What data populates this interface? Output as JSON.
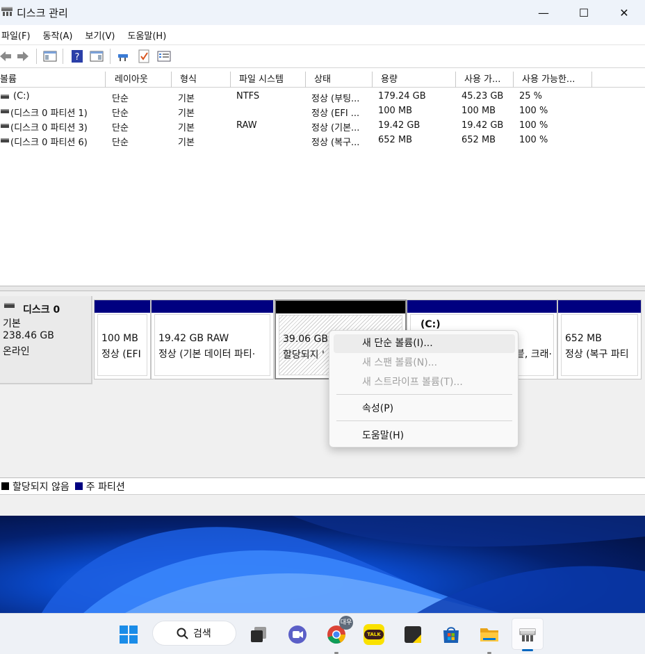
{
  "window": {
    "title": "디스크 관리",
    "minimize_glyph": "—",
    "maximize_glyph": "☐",
    "close_glyph": "✕"
  },
  "menu": [
    "파일(F)",
    "동작(A)",
    "보기(V)",
    "도움말(H)"
  ],
  "toolbar": {
    "icons": [
      "back-arrow-icon",
      "forward-arrow-icon",
      "show-hide-console-tree-icon",
      "help-icon",
      "show-hide-action-pane-icon",
      "connect-icon",
      "checklist-icon",
      "properties-icon"
    ]
  },
  "volume_table": {
    "columns": [
      "볼륨",
      "레이아웃",
      "형식",
      "파일 시스템",
      "상태",
      "용량",
      "사용 가...",
      "사용 가능한..."
    ],
    "rows": [
      [
        "(C:)",
        "단순",
        "기본",
        "NTFS",
        "정상 (부팅...",
        "179.24 GB",
        "45.23 GB",
        "25 %"
      ],
      [
        "(디스크 0 파티션 1)",
        "단순",
        "기본",
        "",
        "정상 (EFI ...",
        "100 MB",
        "100 MB",
        "100 %"
      ],
      [
        "(디스크 0 파티션 3)",
        "단순",
        "기본",
        "RAW",
        "정상 (기본...",
        "19.42 GB",
        "19.42 GB",
        "100 %"
      ],
      [
        "(디스크 0 파티션 6)",
        "단순",
        "기본",
        "",
        "정상 (복구...",
        "652 MB",
        "652 MB",
        "100 %"
      ]
    ]
  },
  "disk": {
    "name": "디스크 0",
    "type": "기본",
    "size": "238.46 GB",
    "state": "온라인",
    "partitions": [
      {
        "line1": "100 MB",
        "line2": "정상 (EFI"
      },
      {
        "line1": "19.42 GB RAW",
        "line2": "정상 (기본 데이터 파티·"
      },
      {
        "line1": "39.06 GB",
        "line2": "할당되지 '"
      },
      {
        "line1": "(C:)",
        "line2": "븥, 크래·"
      },
      {
        "line1": "652 MB",
        "line2": "정상 (복구 파티"
      }
    ]
  },
  "legend": {
    "unallocated": "할당되지 않음",
    "primary": "주 파티션",
    "colors": {
      "unallocated": "#000000",
      "primary": "#000080"
    }
  },
  "context_menu": {
    "items": [
      {
        "label": "새 단순 볼륨(I)...",
        "enabled": true
      },
      {
        "label": "새 스팬 볼륨(N)...",
        "enabled": false
      },
      {
        "label": "새 스트라이프 볼륨(T)...",
        "enabled": false
      },
      {
        "label": "속성(P)",
        "enabled": true
      },
      {
        "label": "도움말(H)",
        "enabled": true
      }
    ]
  },
  "taskbar": {
    "search_label": "검색",
    "apps": [
      "start-icon",
      "task-view-icon",
      "teams-chat-icon",
      "chrome-icon",
      "kakaotalk-icon",
      "sticky-notes-icon",
      "microsoft-store-icon",
      "file-explorer-icon",
      "disk-management-icon"
    ],
    "chrome_badge": "대우",
    "kakao_label": "TALK"
  }
}
